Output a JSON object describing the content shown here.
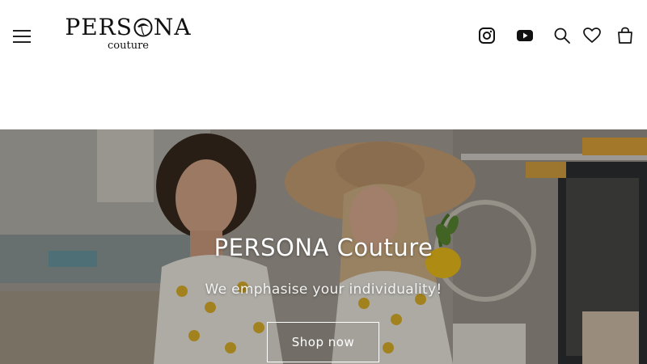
{
  "header": {
    "logo": {
      "main": "PERS",
      "main_after": "NA",
      "sub": "couture"
    },
    "icons": {
      "menu": "hamburger-menu-icon",
      "instagram": "instagram-icon",
      "youtube": "youtube-icon",
      "search": "search-icon",
      "wishlist": "heart-icon",
      "cart": "shopping-bag-icon"
    }
  },
  "hero": {
    "title": "PERSONA Couture",
    "subtitle": "We emphasise your individuality!",
    "cta_label": "Shop now"
  }
}
